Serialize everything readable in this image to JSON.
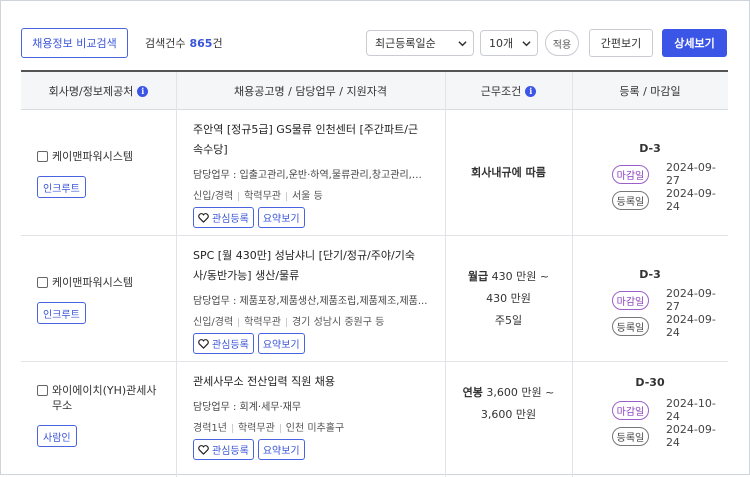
{
  "toolbar": {
    "compare_label": "채용정보 비교검색",
    "count_label": "검색건수",
    "count_value": "865",
    "count_unit": "건",
    "sort_selected": "최근등록일순",
    "page_size_selected": "10개",
    "apply_label": "적용",
    "simple_view_label": "간편보기",
    "detail_view_label": "상세보기"
  },
  "table": {
    "headers": {
      "company": "회사명/정보제공처",
      "posting": "채용공고명 / 담당업무 / 지원자격",
      "conditions": "근무조건",
      "dates": "등록 / 마감일"
    },
    "info_glyph": "i",
    "action_favorite": "관심등록",
    "action_summary": "요약보기",
    "chip_deadline": "마감일",
    "chip_registered": "등록일",
    "rows": [
      {
        "company": "케이맨파워시스템",
        "source": "인크루트",
        "title": "주안역 [정규5급] GS물류 인천센터 [주간파트/근속수당]",
        "duty": "담당업무 : 입출고관리,운반·하역,물류관리,창고관리,유...",
        "career": "신입/경력",
        "education": "학력무관",
        "location": "서울 등",
        "work_lines": [
          "회사내규에 따름"
        ],
        "dday": "D-3",
        "deadline": "2024-09-27",
        "registered": "2024-09-24"
      },
      {
        "company": "케이맨파워시스템",
        "source": "인크루트",
        "title": "SPC [월 430만] 성남샤니 [단기/정규/주야/기숙사/동반가능] 생산/물류",
        "duty": "담당업무 : 제품포장,제품생산,제품조립,제품제조,제품...",
        "career": "신입/경력",
        "education": "학력무관",
        "location": "경기 성남시 중원구 등",
        "work_pay_label": "월급",
        "work_lines": [
          "430 만원 ~",
          "430 만원",
          "주5일"
        ],
        "dday": "D-3",
        "deadline": "2024-09-27",
        "registered": "2024-09-24"
      },
      {
        "company": "와이에이치(YH)관세사무소",
        "source": "사람인",
        "title": "관세사무소 전산입력 직원 채용",
        "duty": "담당업무 : 회계·세무·재무",
        "career": "경력1년",
        "education": "학력무관",
        "location": "인천 미추홀구",
        "work_pay_label": "연봉",
        "work_lines": [
          "3,600 만원 ~",
          "3,600 만원"
        ],
        "dday": "D-30",
        "deadline": "2024-10-24",
        "registered": "2024-09-24"
      }
    ]
  }
}
